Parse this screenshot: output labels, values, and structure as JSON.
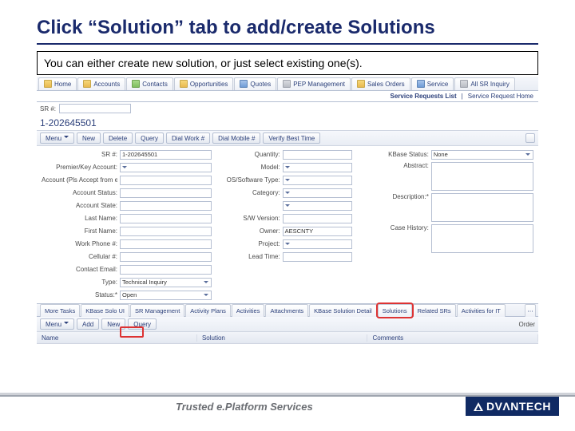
{
  "slide": {
    "title": "Click “Solution” tab to add/create Solutions",
    "instruction": "You can either create  new solution, or just select existing one(s)."
  },
  "topnav": {
    "tabs": [
      "Home",
      "Accounts",
      "Contacts",
      "Opportunities",
      "Quotes",
      "PEP Management",
      "Sales Orders",
      "Service",
      "All SR Inquiry"
    ],
    "sub": {
      "left": "SR #:",
      "list": "Service Requests List",
      "home": "Service Request Home"
    }
  },
  "record": {
    "title": "1-202645501"
  },
  "toolbar": {
    "menu": "Menu",
    "new": "New",
    "delete": "Delete",
    "query": "Query",
    "dialwork": "Dial Work #",
    "dialmobile": "Dial Mobile #",
    "verify": "Verify Best Time"
  },
  "form": {
    "col1": [
      {
        "label": "SR #:",
        "value": "1-202645501",
        "type": "fld"
      },
      {
        "label": "Premier/Key Account:",
        "value": "",
        "type": "dd"
      },
      {
        "label": "Account (Pls Accept from e-Mail):",
        "value": "",
        "type": "fld"
      },
      {
        "label": "Account Status:",
        "value": "",
        "type": "fld"
      },
      {
        "label": "Account State:",
        "value": "",
        "type": "fld"
      },
      {
        "label": "Last Name:",
        "value": "",
        "type": "fld"
      },
      {
        "label": "First Name:",
        "value": "",
        "type": "fld"
      },
      {
        "label": "Work Phone #:",
        "value": "",
        "type": "fld"
      },
      {
        "label": "Cellular #:",
        "value": "",
        "type": "fld"
      },
      {
        "label": "Contact Email:",
        "value": "",
        "type": "fld"
      },
      {
        "label": "Type:",
        "value": "Technical Inquiry",
        "type": "dd"
      },
      {
        "label": "Status:*",
        "value": "Open",
        "type": "dd"
      }
    ],
    "col2": [
      {
        "label": "Quantity:",
        "value": "",
        "type": "fld"
      },
      {
        "label": "Model:",
        "value": "",
        "type": "dd"
      },
      {
        "label": "OS/Software Type:",
        "value": "",
        "type": "dd"
      },
      {
        "label": "Category:",
        "value": "",
        "type": "dd"
      },
      {
        "label": "",
        "value": "",
        "type": "dd"
      },
      {
        "label": "S/W Version:",
        "value": "",
        "type": "fld"
      },
      {
        "label": "Owner:",
        "value": "AESCNTY",
        "type": "fld"
      },
      {
        "label": "Project:",
        "value": "",
        "type": "dd"
      },
      {
        "label": "Lead Time:",
        "value": "",
        "type": "fld"
      }
    ],
    "col3": [
      {
        "label": "KBase Status:",
        "value": "None",
        "type": "dd"
      },
      {
        "label": "Abstract:",
        "type": "ta"
      },
      {
        "label": "Description:*",
        "type": "ta"
      },
      {
        "label": "Case History:",
        "type": "ta"
      }
    ]
  },
  "subtabs": [
    "More Tasks",
    "KBase Solo UI",
    "SR Management",
    "Activity Plans",
    "Activities",
    "Attachments",
    "KBase Solution Detail",
    "Solutions",
    "Related SRs",
    "Activities for IT"
  ],
  "listtb": {
    "menu": "Menu",
    "add": "Add",
    "new": "New",
    "query": "Query",
    "right": "Order"
  },
  "listhead": {
    "name": "Name",
    "solution": "Solution",
    "comments": "Comments"
  },
  "footer": {
    "tag_before": "Trusted ",
    "tag_e": "e.",
    "tag_after": "Platform Services",
    "brand": "DVΛNTECH"
  }
}
